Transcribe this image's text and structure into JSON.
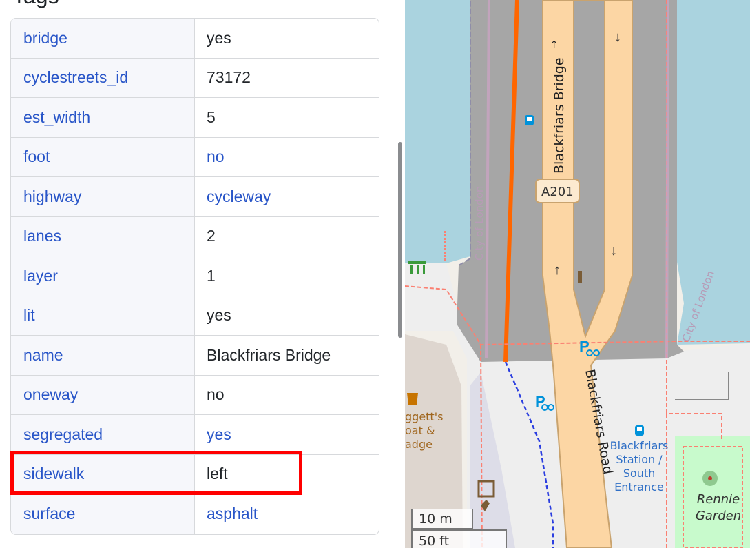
{
  "section": {
    "title": "Tags"
  },
  "tags": [
    {
      "key": "bridge",
      "value": "yes",
      "value_link": false
    },
    {
      "key": "cyclestreets_id",
      "value": "73172",
      "value_link": false
    },
    {
      "key": "est_width",
      "value": "5",
      "value_link": false
    },
    {
      "key": "foot",
      "value": "no",
      "value_link": true
    },
    {
      "key": "highway",
      "value": "cycleway",
      "value_link": true
    },
    {
      "key": "lanes",
      "value": "2",
      "value_link": false
    },
    {
      "key": "layer",
      "value": "1",
      "value_link": false
    },
    {
      "key": "lit",
      "value": "yes",
      "value_link": false
    },
    {
      "key": "name",
      "value": "Blackfriars Bridge",
      "value_link": false
    },
    {
      "key": "oneway",
      "value": "no",
      "value_link": false
    },
    {
      "key": "segregated",
      "value": "yes",
      "value_link": true
    },
    {
      "key": "sidewalk",
      "value": "left",
      "value_link": false
    },
    {
      "key": "surface",
      "value": "asphalt",
      "value_link": true
    }
  ],
  "highlighted_tag": "sidewalk",
  "map": {
    "road_label_bridge": "Blackfriars Bridge",
    "road_ref": "A201",
    "road_label_road": "Blackfriars Road",
    "boundary_label_left": "City of London",
    "boundary_label_right": "City of London",
    "station_label": [
      "Blackfriars",
      "Station /",
      "South",
      "Entrance"
    ],
    "garden_label": [
      "Rennie",
      "Garden"
    ],
    "pub_label": [
      "ggett's",
      "oat &",
      "adge"
    ],
    "scale": {
      "metric": "10 m",
      "imperial": "50 ft"
    }
  },
  "colors": {
    "link": "#2855c8",
    "highlight": "#ff0000",
    "water": "#aad3df",
    "bridge": "#a6a6a6",
    "primary_road": "#fcd6a4",
    "cycleway": "#ff6600",
    "park": "#c8facc",
    "bicycle_parking": "#0092da"
  }
}
